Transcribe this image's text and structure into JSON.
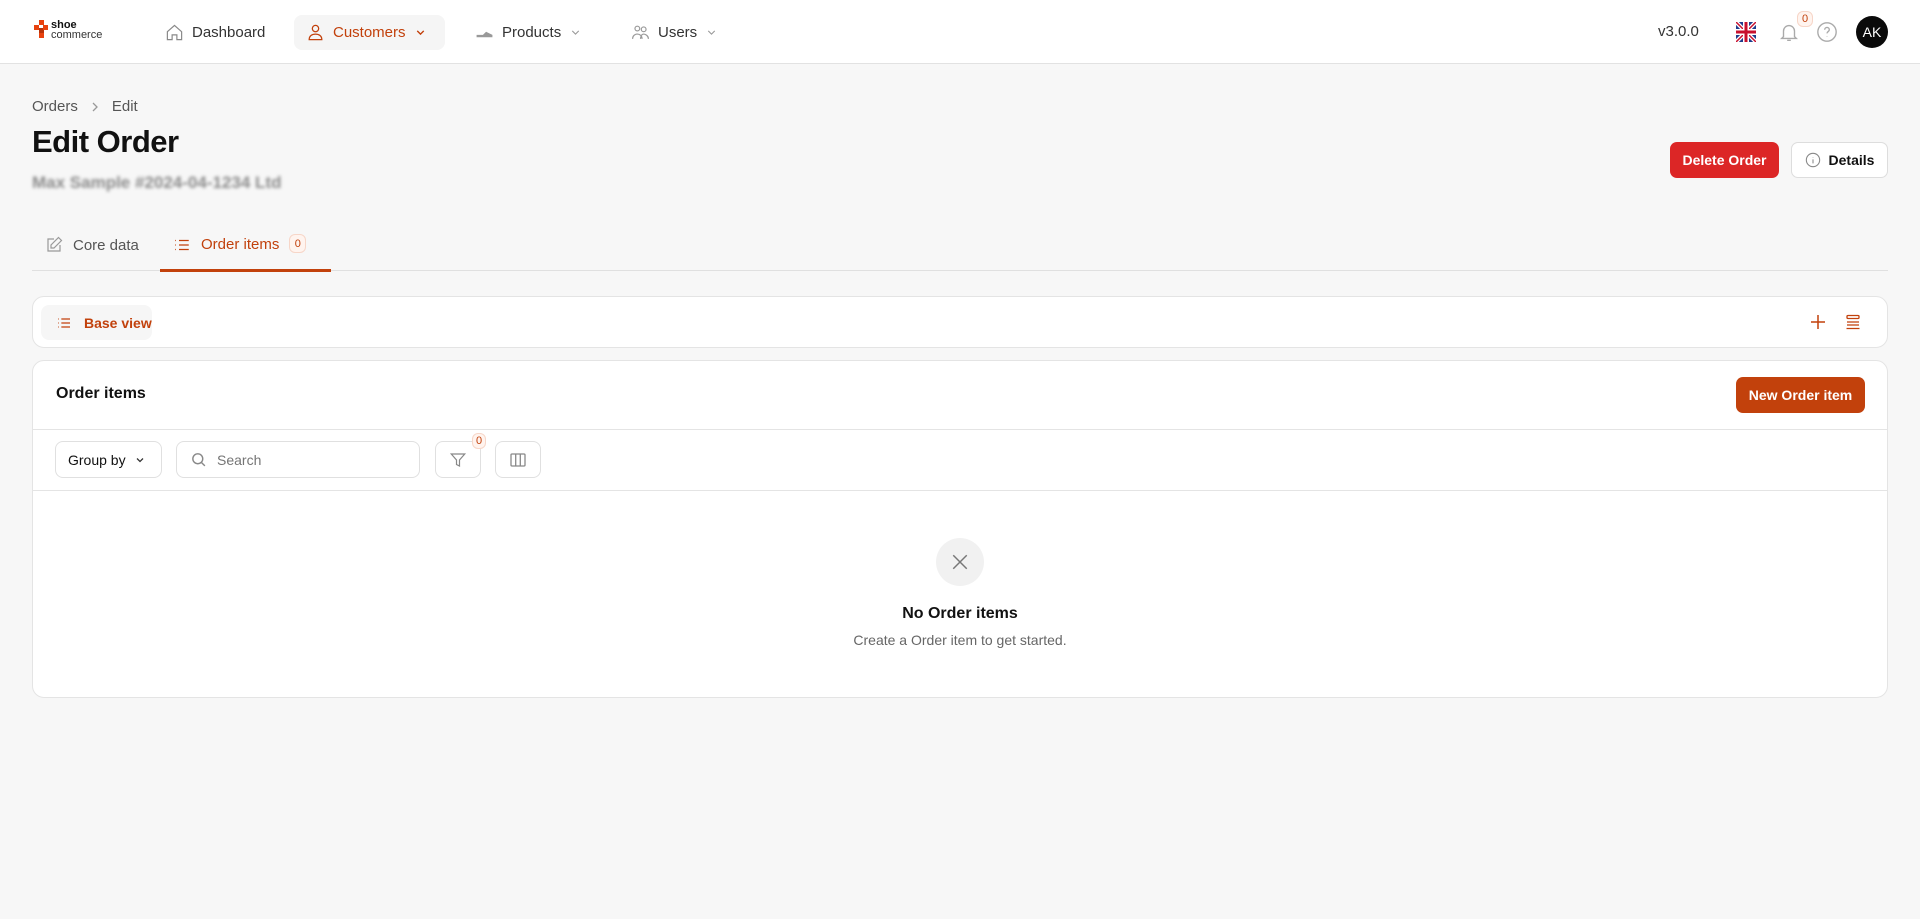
{
  "brand": {
    "logo_top": "shoe",
    "logo_bottom": "commerce",
    "accent": "#c2410c",
    "danger": "#dc2626"
  },
  "nav": {
    "items": [
      {
        "label": "Dashboard",
        "icon": "home-icon"
      },
      {
        "label": "Customers",
        "icon": "user-icon",
        "active": true
      },
      {
        "label": "Products",
        "icon": "shoe-icon"
      },
      {
        "label": "Users",
        "icon": "users-icon"
      }
    ]
  },
  "header": {
    "version": "v3.0.0",
    "notifications": "0",
    "avatar": "AK",
    "language": "uk-flag-icon"
  },
  "breadcrumb": [
    "Orders",
    "Edit"
  ],
  "page": {
    "title": "Edit Order",
    "subtitle_redacted": "Max Sample #2024-04-1234 Ltd",
    "delete_label": "Delete Order",
    "details_label": "Details"
  },
  "tabs": [
    {
      "label": "Core data",
      "icon": "pencil-icon"
    },
    {
      "label": "Order items",
      "icon": "list-icon",
      "count": "0",
      "active": true
    }
  ],
  "views": {
    "base_view": "Base view"
  },
  "table": {
    "title": "Order items",
    "new_label": "New Order item",
    "group_by": "Group by",
    "search_placeholder": "Search",
    "filter_count": "0"
  },
  "empty": {
    "title": "No Order items",
    "message": "Create a Order item to get started."
  }
}
